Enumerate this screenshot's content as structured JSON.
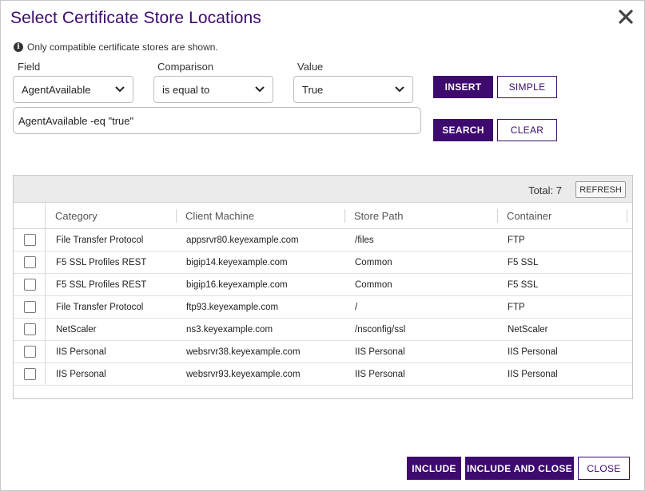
{
  "dialog": {
    "title": "Select Certificate Store Locations",
    "info_text": "Only compatible certificate stores are shown."
  },
  "filter": {
    "field_label": "Field",
    "comparison_label": "Comparison",
    "value_label": "Value",
    "field_value": "AgentAvailable",
    "comparison_value": "is equal to",
    "value_value": "True",
    "query": "AgentAvailable -eq \"true\"",
    "insert_label": "INSERT",
    "simple_label": "SIMPLE",
    "search_label": "SEARCH",
    "clear_label": "CLEAR"
  },
  "grid": {
    "total_label": "Total: 7",
    "refresh_label": "REFRESH",
    "columns": [
      "Category",
      "Client Machine",
      "Store Path",
      "Container"
    ],
    "rows": [
      {
        "category": "File Transfer Protocol",
        "client_machine": "appsrvr80.keyexample.com",
        "store_path": "/files",
        "container": "FTP"
      },
      {
        "category": "F5 SSL Profiles REST",
        "client_machine": "bigip14.keyexample.com",
        "store_path": "Common",
        "container": "F5 SSL"
      },
      {
        "category": "F5 SSL Profiles REST",
        "client_machine": "bigip16.keyexample.com",
        "store_path": "Common",
        "container": "F5 SSL"
      },
      {
        "category": "File Transfer Protocol",
        "client_machine": "ftp93.keyexample.com",
        "store_path": "/",
        "container": "FTP"
      },
      {
        "category": "NetScaler",
        "client_machine": "ns3.keyexample.com",
        "store_path": "/nsconfig/ssl",
        "container": "NetScaler"
      },
      {
        "category": "IIS Personal",
        "client_machine": "websrvr38.keyexample.com",
        "store_path": "IIS Personal",
        "container": "IIS Personal"
      },
      {
        "category": "IIS Personal",
        "client_machine": "websrvr93.keyexample.com",
        "store_path": "IIS Personal",
        "container": "IIS Personal"
      }
    ]
  },
  "footer": {
    "include_label": "INCLUDE",
    "include_close_label": "INCLUDE AND CLOSE",
    "close_label": "CLOSE"
  },
  "icons": {
    "close": "close-icon",
    "info": "info-icon",
    "dropdown": "chevron-down-icon"
  },
  "colors": {
    "brand": "#3d0a6e"
  }
}
